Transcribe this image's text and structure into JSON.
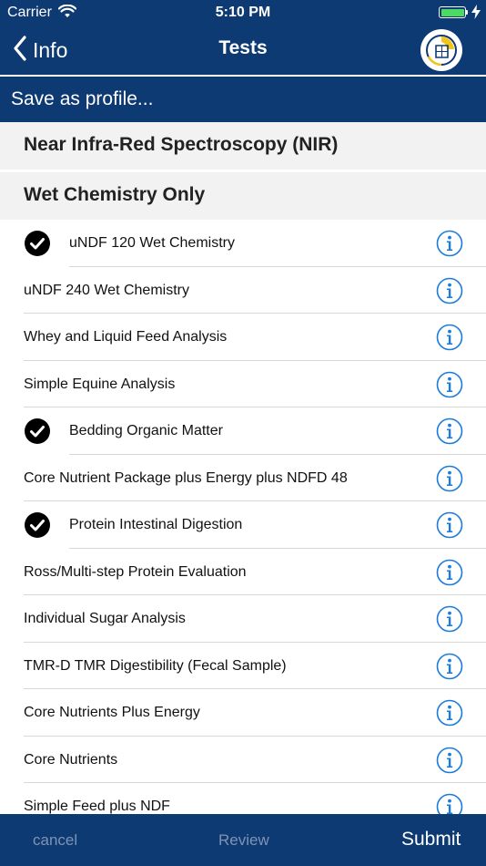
{
  "status_bar": {
    "carrier": "Carrier",
    "time": "5:10 PM",
    "battery_color": "#4cd964"
  },
  "nav": {
    "back_label": "Info",
    "title": "Tests",
    "logo_icon": "company-logo"
  },
  "save_profile_label": "Save as profile...",
  "sections": {
    "nir": "Near Infra-Red Spectroscopy (NIR)",
    "wet": "Wet Chemistry Only"
  },
  "tests": [
    {
      "label": "uNDF 120 Wet Chemistry",
      "checked": true
    },
    {
      "label": "uNDF 240 Wet Chemistry",
      "checked": false
    },
    {
      "label": "Whey and Liquid Feed Analysis",
      "checked": false
    },
    {
      "label": "Simple Equine Analysis",
      "checked": false
    },
    {
      "label": "Bedding Organic Matter",
      "checked": true
    },
    {
      "label": "Core Nutrient Package plus Energy plus NDFD 48",
      "checked": false
    },
    {
      "label": "Protein Intestinal Digestion",
      "checked": true
    },
    {
      "label": "Ross/Multi-step Protein Evaluation",
      "checked": false
    },
    {
      "label": "Individual Sugar Analysis",
      "checked": false
    },
    {
      "label": "TMR-D TMR Digestibility (Fecal Sample)",
      "checked": false
    },
    {
      "label": "Core Nutrients Plus Energy",
      "checked": false
    },
    {
      "label": "Core Nutrients",
      "checked": false
    },
    {
      "label": "Simple Feed plus NDF",
      "checked": false
    }
  ],
  "tab_bar": {
    "cancel": "cancel",
    "review": "Review",
    "submit": "Submit"
  },
  "colors": {
    "brand_navy": "#0e3a74",
    "info_blue": "#1a7bdc",
    "section_bg": "#f2f2f2"
  }
}
